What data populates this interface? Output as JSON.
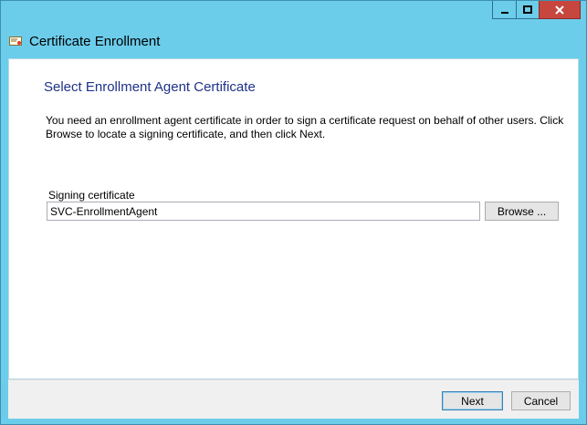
{
  "window": {
    "title": "Certificate Enrollment",
    "controls": {
      "minimize_icon": "minimize-icon",
      "maximize_icon": "maximize-icon",
      "close_icon": "close-icon"
    }
  },
  "page": {
    "heading": "Select Enrollment Agent Certificate",
    "description": "You need an enrollment agent certificate in order to sign a certificate request on behalf of other users. Click Browse to locate a signing certificate, and then click Next."
  },
  "signing": {
    "label": "Signing certificate",
    "value": "SVC-EnrollmentAgent",
    "browse_label": "Browse ..."
  },
  "footer": {
    "next_label": "Next",
    "cancel_label": "Cancel"
  },
  "colors": {
    "frame": "#6ccdeb",
    "heading": "#1e3287",
    "close": "#c7463e"
  }
}
